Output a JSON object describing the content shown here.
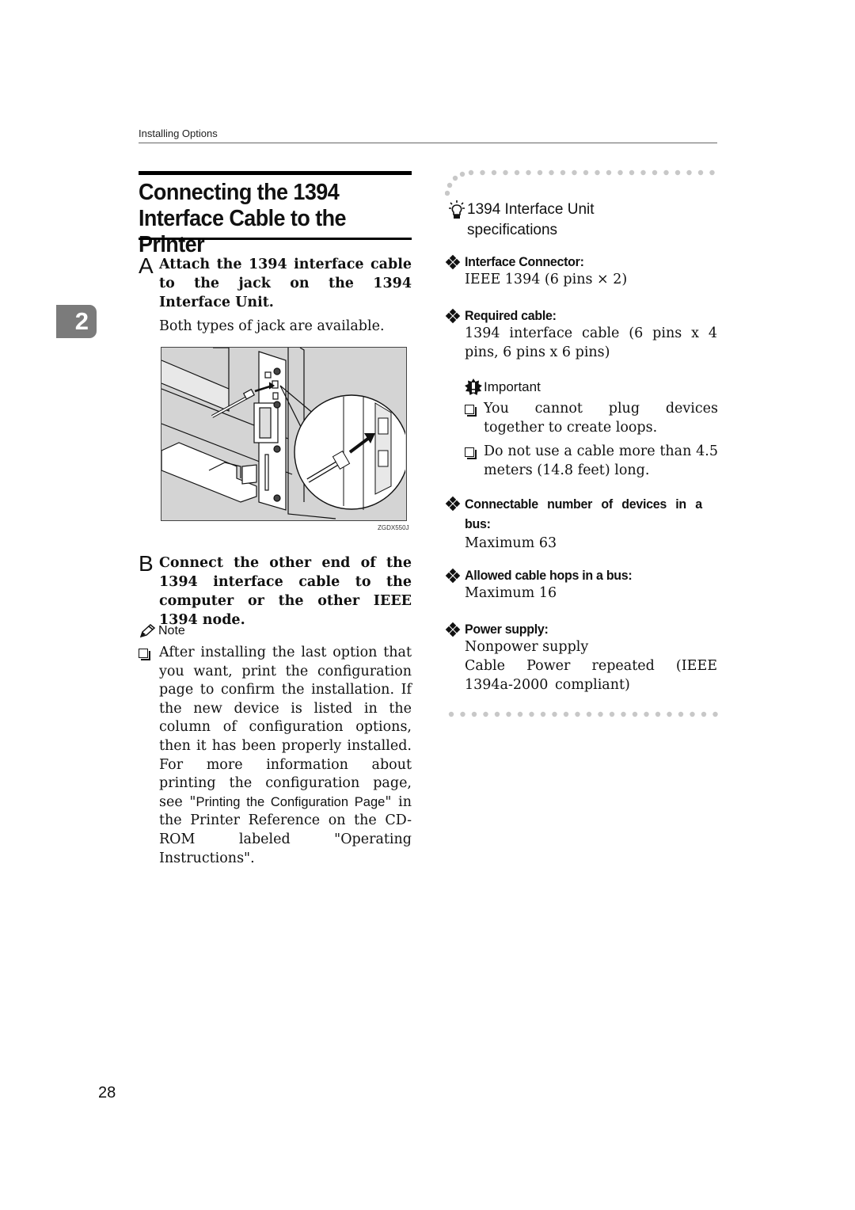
{
  "header": {
    "running_title": "Installing Options",
    "chapter_number": "2"
  },
  "section": {
    "title": "Connecting the 1394 Interface Cable to the Printer"
  },
  "steps": [
    {
      "letter": "A",
      "instruction": "Attach the 1394 interface cable to the jack on the 1394 Interface Unit.",
      "description": "Both types of jack are available."
    },
    {
      "letter": "B",
      "instruction": "Connect the other end of the 1394 interface cable to the computer or the other IEEE 1394 node."
    }
  ],
  "figure": {
    "code": "ZGDX550J",
    "colors": {
      "background": "#d4d4d4",
      "line": "#111111",
      "fill": "#ffffff"
    }
  },
  "note": {
    "heading": "Note",
    "item_part1": "After installing the last option that you want, print the configuration page to confirm the installation. If the new device is listed in the column of configuration options, then it has been properly installed. For more information about printing the configuration page, see \"",
    "item_link": "Printing the Configuration Page",
    "item_part2": "\" in the Printer Reference on the CD-ROM labeled \"Operating Instructions\"."
  },
  "specs": {
    "heading": "1394 Interface Unit specifications",
    "items": [
      {
        "label": "Interface Connector:",
        "value": "IEEE 1394 (6 pins × 2)"
      },
      {
        "label": "Required cable:",
        "value": "1394 interface cable (6 pins x 4 pins, 6 pins x 6 pins)"
      },
      {
        "label": "Connectable number of devices in a bus:",
        "value": "Maximum 63"
      },
      {
        "label": "Allowed cable hops in a bus:",
        "value": "Maximum 16"
      },
      {
        "label": "Power supply:",
        "value_lines": [
          "Nonpower supply",
          "Cable Power repeated (IEEE 1394a-2000 compliant)"
        ]
      }
    ],
    "important": {
      "heading": "Important",
      "items": [
        "You cannot plug devices together to create loops.",
        "Do not use a cable more than 4.5 meters (14.8 feet) long."
      ]
    }
  },
  "footer": {
    "page_number": "28"
  },
  "colors": {
    "chapter_tab": "#7b7b7b",
    "dots": "#c8c8c8",
    "text": "#111111"
  }
}
